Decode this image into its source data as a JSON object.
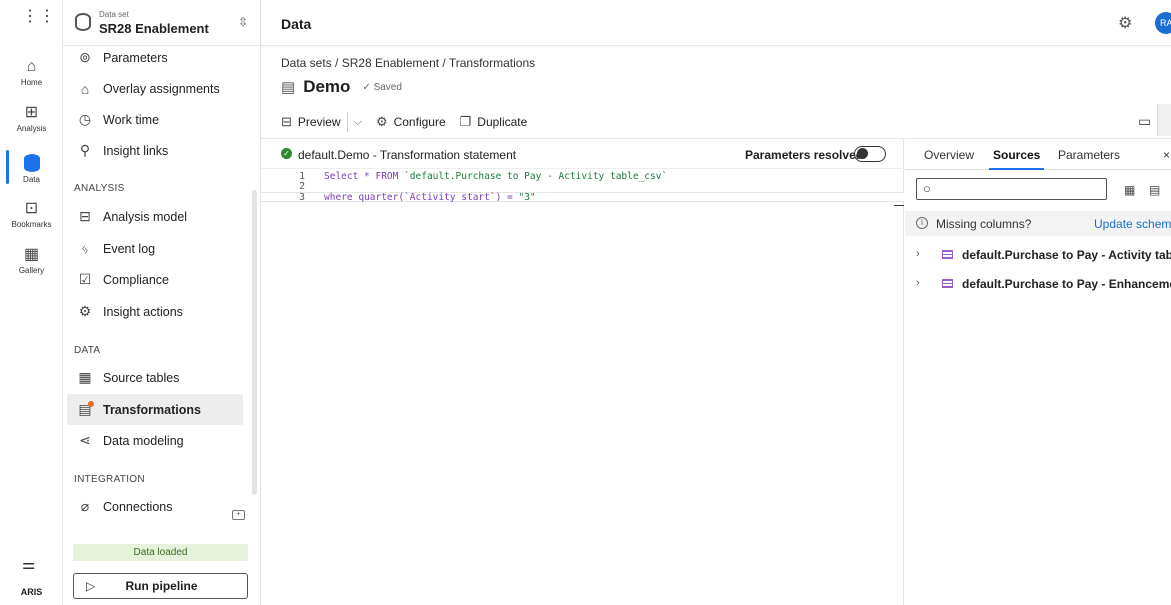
{
  "rail": {
    "items": [
      {
        "label": "Home",
        "icon": "home-icon"
      },
      {
        "label": "Analysis",
        "icon": "analysis-icon"
      },
      {
        "label": "Data",
        "icon": "database-icon"
      },
      {
        "label": "Bookmarks",
        "icon": "bookmark-icon"
      },
      {
        "label": "Gallery",
        "icon": "gallery-icon"
      }
    ],
    "brand": "ARIS"
  },
  "dataset": {
    "caption": "Data set",
    "name": "SR28 Enablement"
  },
  "sidebar": {
    "items_top": [
      "Parameters",
      "Overlay assignments",
      "Work time",
      "Insight links"
    ],
    "analysis_header": "ANALYSIS",
    "analysis_items": [
      "Analysis model",
      "Event log",
      "Compliance",
      "Insight actions"
    ],
    "data_header": "DATA",
    "data_items": [
      "Source tables",
      "Transformations",
      "Data modeling"
    ],
    "integration_header": "INTEGRATION",
    "integration_items": [
      "Connections"
    ],
    "status": "Data loaded",
    "run_label": "Run pipeline",
    "selected": "Transformations"
  },
  "header": {
    "title": "Data",
    "avatar": "RA"
  },
  "breadcrumb": "Data sets / SR28 Enablement / Transformations",
  "page": {
    "title": "Demo",
    "status": "✓ Saved"
  },
  "toolbar": {
    "preview": "Preview",
    "configure": "Configure",
    "duplicate": "Duplicate"
  },
  "editor": {
    "title": "default.Demo - Transformation statement",
    "params_label": "Parameters resolved",
    "lines": [
      {
        "n": "1",
        "kw": "Select * FROM ",
        "str": "`default.Purchase to Pay - Activity table_csv`"
      },
      {
        "n": "2",
        "kw": "",
        "str": ""
      },
      {
        "n": "3",
        "kw": "where quarter(`Activity start`) = ",
        "str": "\"3\""
      }
    ]
  },
  "panel": {
    "tabs": [
      "Overview",
      "Sources",
      "Parameters"
    ],
    "active_tab": "Sources",
    "missing": "Missing columns?",
    "update": "Update schemas",
    "sources": [
      "default.Purchase to Pay - Activity table_...",
      "default.Purchase to Pay - Enhancement ..."
    ]
  },
  "colors": {
    "accent": "#1a73e8",
    "loaded_bg": "#e6f2dc",
    "badge": "#e86a1c"
  }
}
